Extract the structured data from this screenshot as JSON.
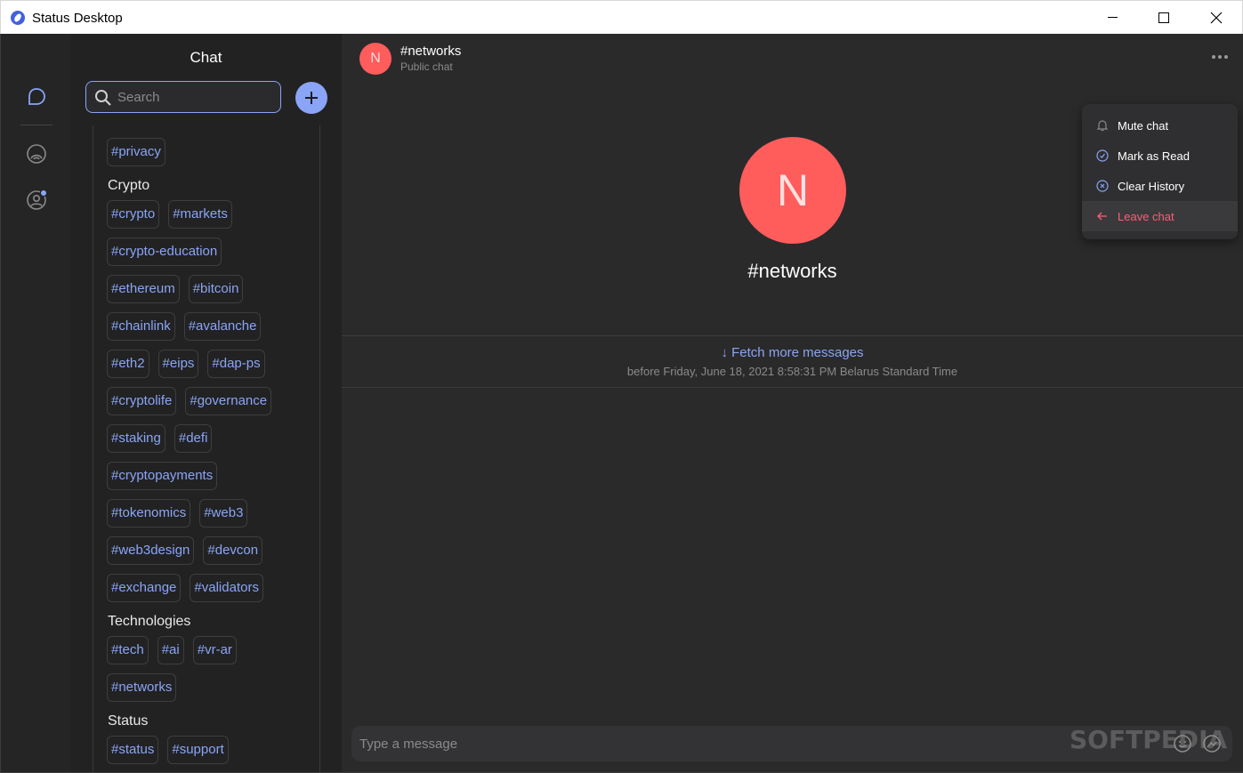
{
  "window": {
    "title": "Status Desktop"
  },
  "sidebar": {
    "chat_title": "Chat",
    "search": {
      "placeholder": "Search",
      "value": ""
    },
    "first_tag": "#privacy",
    "categories": [
      {
        "title": "Crypto",
        "rows": [
          [
            "#crypto",
            "#markets"
          ],
          [
            "#crypto-education"
          ],
          [
            "#ethereum",
            "#bitcoin"
          ],
          [
            "#chainlink",
            "#avalanche"
          ],
          [
            "#eth2",
            "#eips",
            "#dap-ps"
          ],
          [
            "#cryptolife",
            "#governance"
          ],
          [
            "#staking",
            "#defi"
          ],
          [
            "#cryptopayments"
          ],
          [
            "#tokenomics",
            "#web3"
          ],
          [
            "#web3design",
            "#devcon"
          ],
          [
            "#exchange",
            "#validators"
          ]
        ]
      },
      {
        "title": "Technologies",
        "rows": [
          [
            "#tech",
            "#ai",
            "#vr-ar"
          ],
          [
            "#networks"
          ]
        ]
      },
      {
        "title": "Status",
        "rows": [
          [
            "#status",
            "#support"
          ]
        ]
      }
    ]
  },
  "chat": {
    "avatar_letter": "N",
    "name": "#networks",
    "subtitle": "Public chat",
    "big_avatar_letter": "N",
    "big_name": "#networks",
    "fetch_label": "↓ Fetch more messages",
    "fetch_sub": "before Friday, June 18, 2021 8:58:31 PM Belarus Standard Time",
    "composer_placeholder": "Type a message",
    "avatar_color": "#ff5c5c"
  },
  "menu": {
    "items": [
      {
        "label": "Mute chat",
        "icon": "bell-icon"
      },
      {
        "label": "Mark as Read",
        "icon": "check-circle-icon"
      },
      {
        "label": "Clear History",
        "icon": "close-circle-icon"
      },
      {
        "label": "Leave chat",
        "icon": "arrow-left-icon"
      }
    ]
  },
  "watermark": "SOFTPEDIA",
  "colors": {
    "accent": "#8aa5f5",
    "danger": "#ff5c7a",
    "background": "#2a2a2b"
  }
}
